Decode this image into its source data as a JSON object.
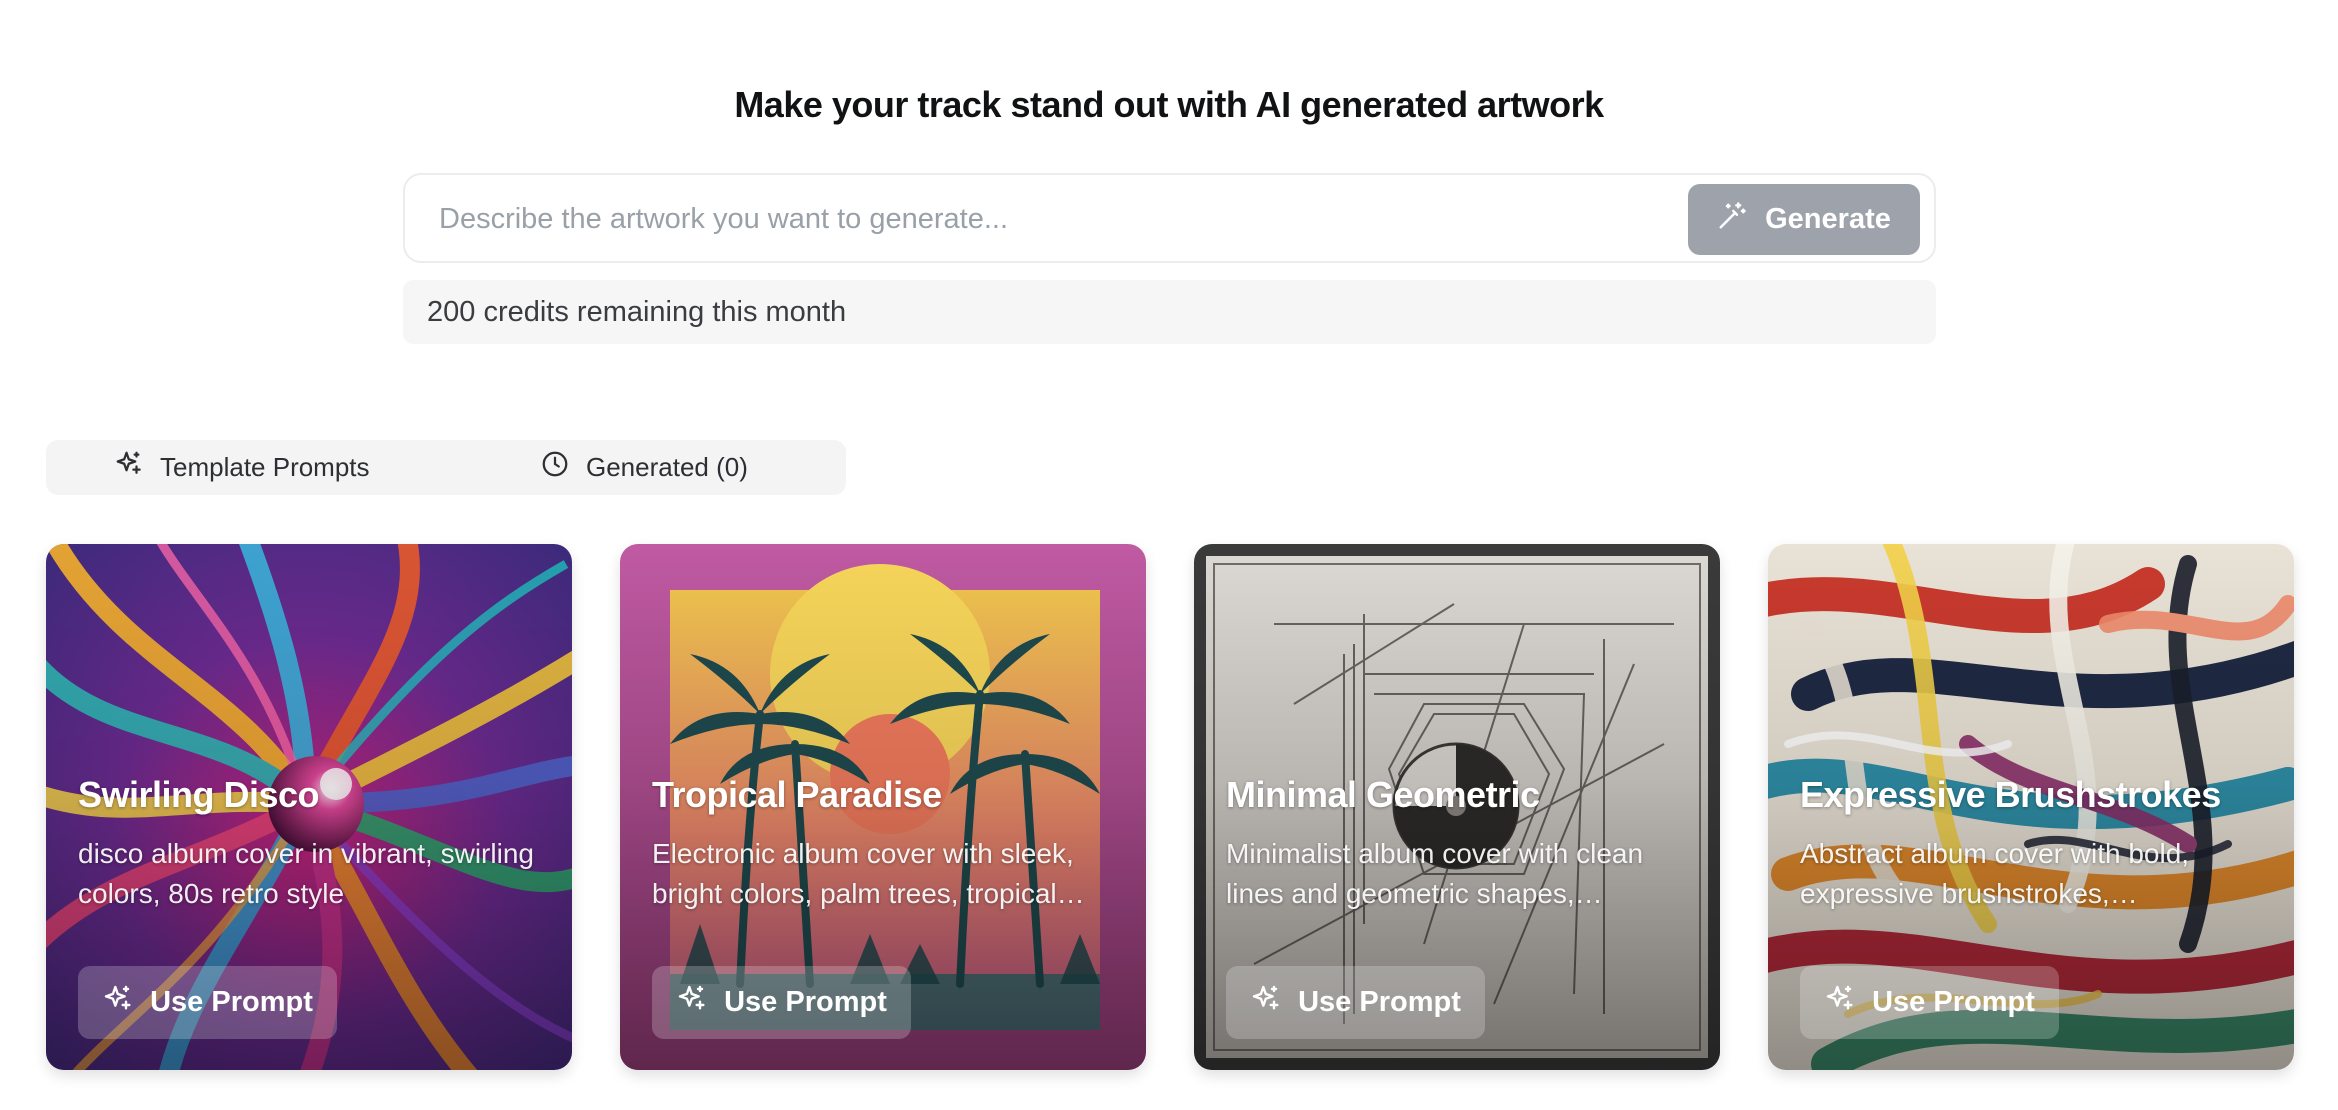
{
  "header": {
    "title": "Make your track stand out with AI generated artwork"
  },
  "prompt": {
    "placeholder": "Describe the artwork you want to generate...",
    "value": "",
    "generate_label": "Generate"
  },
  "credits": {
    "text": "200 credits remaining this month"
  },
  "tabs": [
    {
      "label": "Template Prompts",
      "icon": "sparkles-icon",
      "active": true
    },
    {
      "label": "Generated (0)",
      "icon": "clock-icon",
      "active": false
    }
  ],
  "cards": [
    {
      "title": "Swirling Disco",
      "description": "disco album cover in vibrant, swirling colors, 80s retro style",
      "button": "Use Prompt"
    },
    {
      "title": "Tropical Paradise",
      "description": "Electronic album cover with sleek, bright colors, palm trees, tropical vibes",
      "button": "Use Prompt"
    },
    {
      "title": "Minimal Geometric",
      "description": "Minimalist album cover with clean lines and geometric shapes, monochrome",
      "button": "Use Prompt"
    },
    {
      "title": "Expressive Brushstrokes",
      "description": "Abstract album cover with bold, expressive brushstrokes, Expressionism style",
      "button": "Use Prompt"
    }
  ],
  "colors": {
    "generate_bg": "#9ea3ab",
    "credits_bg": "#f6f6f7",
    "tabs_bg": "#f4f4f5"
  }
}
